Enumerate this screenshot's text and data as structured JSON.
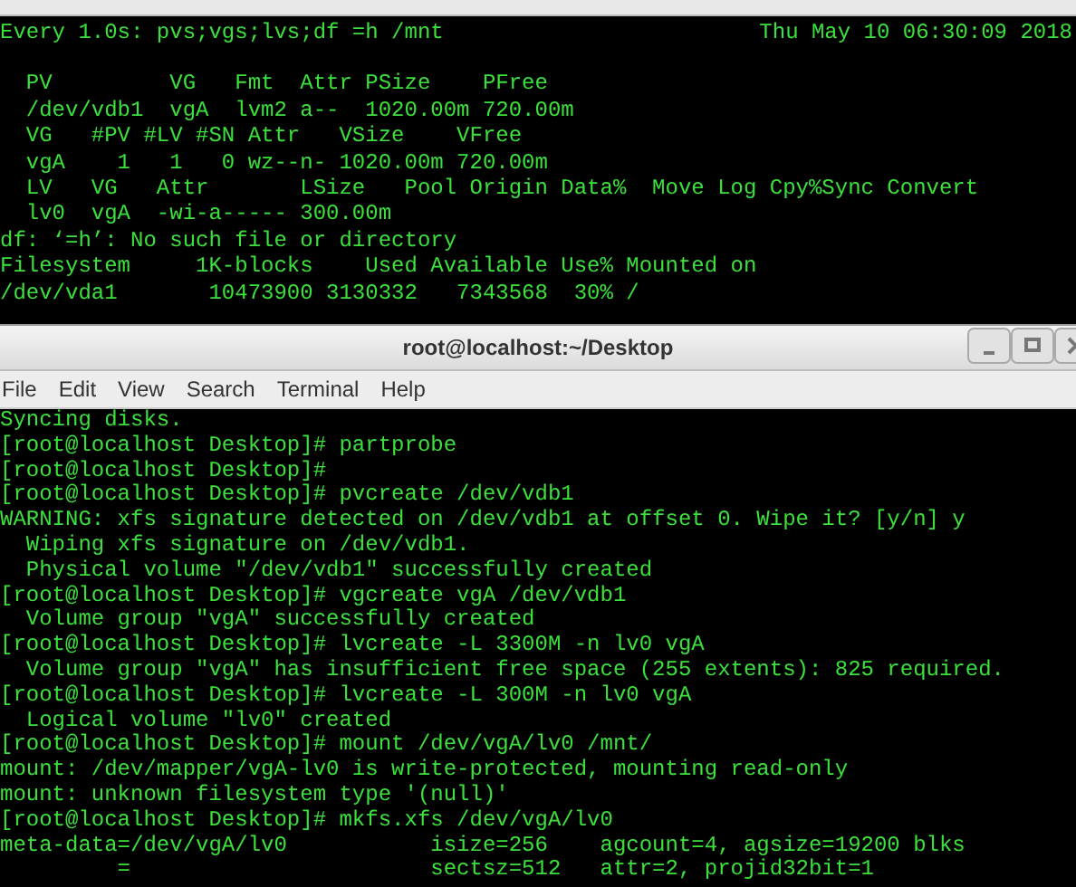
{
  "watch_terminal": {
    "command": "Every 1.0s: pvs;vgs;lvs;df =h /mnt",
    "clock": "Thu May 10 06:30:09 2018",
    "lines": [
      "  PV         VG   Fmt  Attr PSize    PFree",
      "  /dev/vdb1  vgA  lvm2 a--  1020.00m 720.00m",
      "  VG   #PV #LV #SN Attr   VSize    VFree",
      "  vgA    1   1   0 wz--n- 1020.00m 720.00m",
      "  LV   VG   Attr       LSize   Pool Origin Data%  Move Log Cpy%Sync Convert",
      "  lv0  vgA  -wi-a----- 300.00m",
      "df: ‘=h’: No such file or directory",
      "Filesystem     1K-blocks    Used Available Use% Mounted on",
      "/dev/vda1       10473900 3130332   7343568  30% /"
    ]
  },
  "window": {
    "title": "root@localhost:~/Desktop",
    "menu": [
      "File",
      "Edit",
      "View",
      "Search",
      "Terminal",
      "Help"
    ],
    "lines": [
      "Syncing disks.",
      "[root@localhost Desktop]# partprobe",
      "[root@localhost Desktop]#",
      "[root@localhost Desktop]# pvcreate /dev/vdb1",
      "WARNING: xfs signature detected on /dev/vdb1 at offset 0. Wipe it? [y/n] y",
      "  Wiping xfs signature on /dev/vdb1.",
      "  Physical volume \"/dev/vdb1\" successfully created",
      "[root@localhost Desktop]# vgcreate vgA /dev/vdb1",
      "  Volume group \"vgA\" successfully created",
      "[root@localhost Desktop]# lvcreate -L 3300M -n lv0 vgA",
      "  Volume group \"vgA\" has insufficient free space (255 extents): 825 required.",
      "[root@localhost Desktop]# lvcreate -L 300M -n lv0 vgA",
      "  Logical volume \"lv0\" created",
      "[root@localhost Desktop]# mount /dev/vgA/lv0 /mnt/",
      "mount: /dev/mapper/vgA-lv0 is write-protected, mounting read-only",
      "mount: unknown filesystem type '(null)'",
      "[root@localhost Desktop]# mkfs.xfs /dev/vgA/lv0",
      "meta-data=/dev/vgA/lv0           isize=256    agcount=4, agsize=19200 blks",
      "         =                       sectsz=512   attr=2, projid32bit=1"
    ]
  }
}
